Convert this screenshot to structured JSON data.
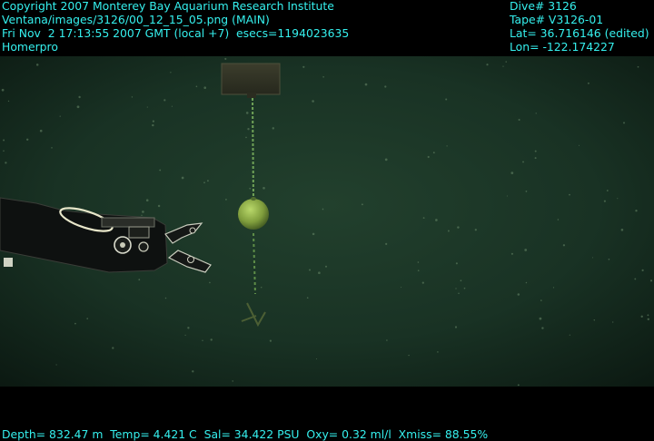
{
  "overlay": {
    "header_left": [
      "Copyright 2007 Monterey Bay Aquarium Research Institute",
      "Ventana/images/3126/00_12_15_05.png (MAIN)",
      "Fri Nov  2 17:13:55 2007 GMT (local +7)  esecs=1194023635",
      "Homerpro"
    ],
    "header_right": [
      "Dive# 3126",
      "Tape# V3126-01",
      "Lat= 36.716146 (edited)",
      "Lon= -122.174227"
    ],
    "footer": "Depth= 832.47 m  Temp= 4.421 C  Sal= 34.422 PSU  Oxy= 0.32 ml/l  Xmiss= 88.55%"
  },
  "colors": {
    "overlay_text": "#35f0ee",
    "water_center": "#1f3a2a",
    "water_edge": "#0c1812",
    "float": "#8fb04a",
    "line": "#7ab05a"
  },
  "icons": {
    "manipulator": "robotic-arm-claw",
    "float": "subsurface-float-buoy",
    "marker": "marker-plate"
  }
}
